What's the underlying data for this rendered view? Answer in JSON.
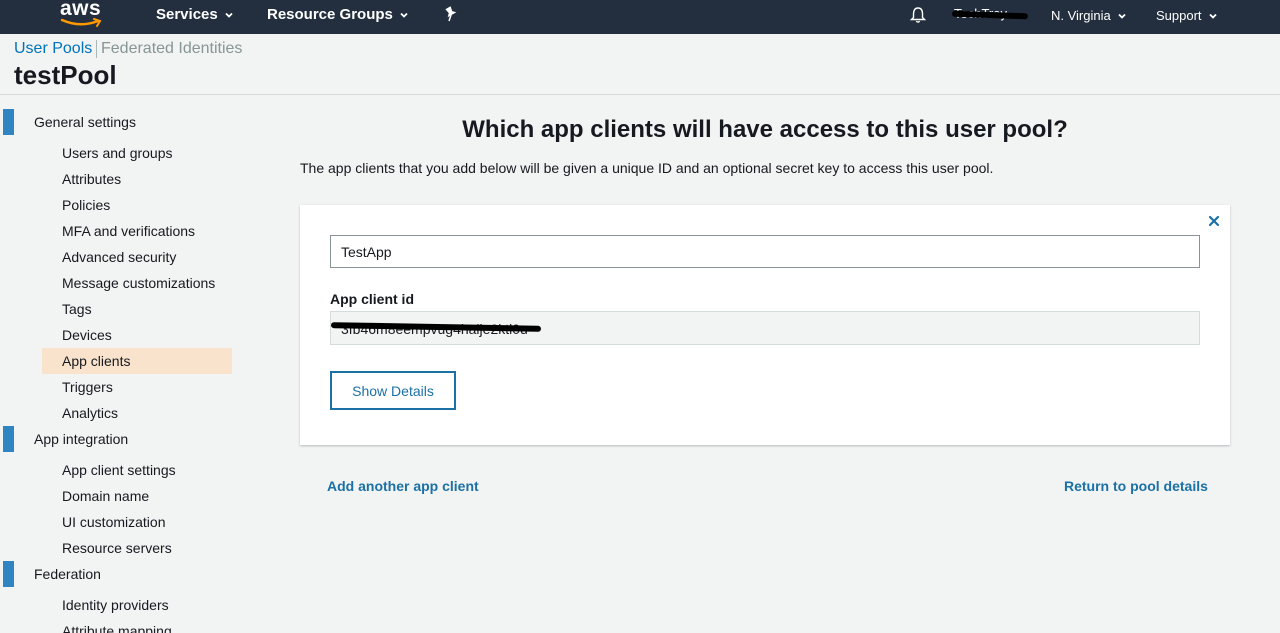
{
  "topnav": {
    "logo_text": "aws",
    "services_label": "Services",
    "resource_groups_label": "Resource Groups",
    "pin_icon": "pin-icon",
    "bell_icon": "bell-icon",
    "account_label": "TechTray",
    "region_label": "N. Virginia",
    "support_label": "Support"
  },
  "header": {
    "crumb_user_pools": "User Pools",
    "crumb_federated": "Federated Identities",
    "pool_name": "testPool"
  },
  "sidebar": {
    "general_settings": "General settings",
    "general_items": [
      "Users and groups",
      "Attributes",
      "Policies",
      "MFA and verifications",
      "Advanced security",
      "Message customizations",
      "Tags",
      "Devices",
      "App clients",
      "Triggers",
      "Analytics"
    ],
    "app_integration": "App integration",
    "app_items": [
      "App client settings",
      "Domain name",
      "UI customization",
      "Resource servers"
    ],
    "federation": "Federation",
    "federation_items": [
      "Identity providers",
      "Attribute mapping"
    ],
    "active_item": "App clients"
  },
  "main": {
    "title": "Which app clients will have access to this user pool?",
    "description": "The app clients that you add below will be given a unique ID and an optional secret key to access this user pool.",
    "app_client_name": "TestApp",
    "app_client_id_label": "App client id",
    "app_client_id_value": "3fb46m8eempvug4haije2ktl0u",
    "show_details_label": "Show Details",
    "add_another_label": "Add another app client",
    "return_label": "Return to pool details"
  },
  "colors": {
    "nav_bg": "#232f3e",
    "link_blue": "#1b71a5",
    "section_bar": "#3184c2",
    "active_bg": "#f9e3cc"
  }
}
